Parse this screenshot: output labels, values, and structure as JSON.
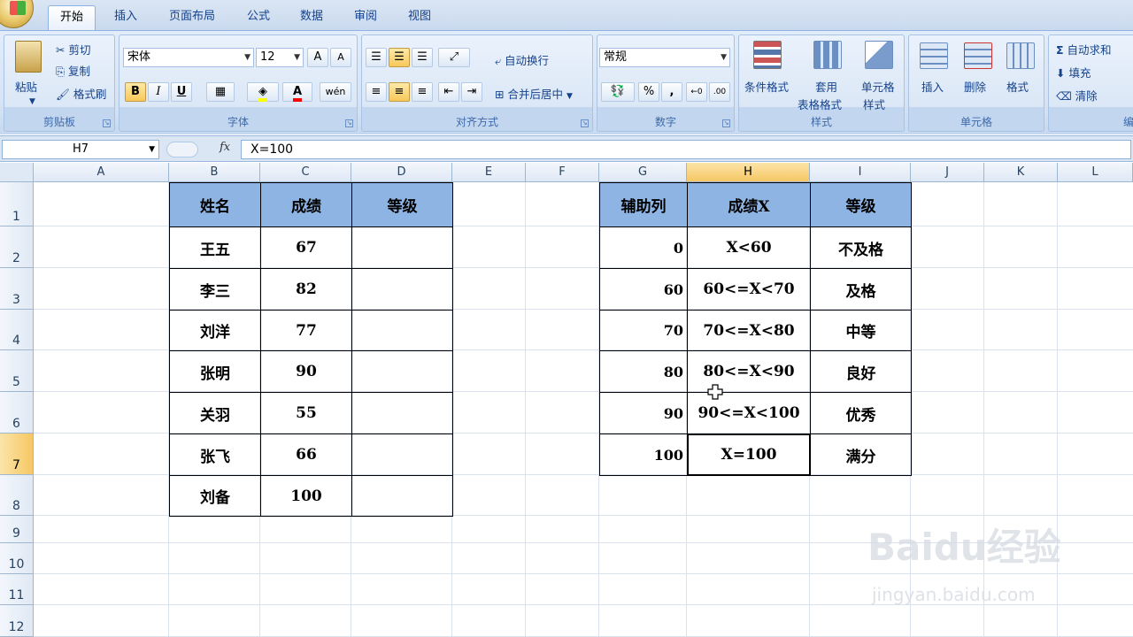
{
  "tabs": [
    "开始",
    "插入",
    "页面布局",
    "公式",
    "数据",
    "审阅",
    "视图"
  ],
  "clipboard": {
    "paste": "粘贴",
    "cut": "剪切",
    "copy": "复制",
    "format_painter": "格式刷",
    "label": "剪贴板"
  },
  "font": {
    "name": "宋体",
    "size": "12",
    "bold": "B",
    "italic": "I",
    "underline": "U",
    "grow": "A",
    "shrink": "A",
    "label": "字体"
  },
  "alignment": {
    "wrap": "自动换行",
    "merge": "合并后居中",
    "label": "对齐方式"
  },
  "number": {
    "format": "常规",
    "percent": "%",
    "comma": ",",
    "label": "数字"
  },
  "styles": {
    "conditional": "条件格式",
    "table_1": "套用",
    "table_2": "表格格式",
    "cell_1": "单元格",
    "cell_2": "样式",
    "label": "样式"
  },
  "cells": {
    "insert": "插入",
    "delete": "删除",
    "format": "格式",
    "label": "单元格"
  },
  "editing": {
    "autosum": "自动求和",
    "fill": "填充",
    "clear": "清除",
    "label": "编"
  },
  "formula_bar": {
    "name_box": "H7",
    "fx": "fx",
    "formula": "X=100"
  },
  "columns": [
    "A",
    "B",
    "C",
    "D",
    "E",
    "F",
    "G",
    "H",
    "I",
    "J",
    "K",
    "L"
  ],
  "selected_column": "H",
  "rows": [
    "1",
    "2",
    "3",
    "4",
    "5",
    "6",
    "7",
    "8",
    "9",
    "10",
    "11",
    "12"
  ],
  "selected_row": "7",
  "table1": {
    "headers": [
      "姓名",
      "成绩",
      "等级"
    ],
    "rows": [
      [
        "王五",
        "67",
        ""
      ],
      [
        "李三",
        "82",
        ""
      ],
      [
        "刘洋",
        "77",
        ""
      ],
      [
        "张明",
        "90",
        ""
      ],
      [
        "关羽",
        "55",
        ""
      ],
      [
        "张飞",
        "66",
        ""
      ],
      [
        "刘备",
        "100",
        ""
      ]
    ]
  },
  "table2": {
    "headers": [
      "辅助列",
      "成绩X",
      "等级"
    ],
    "rows": [
      [
        "0",
        "X<60",
        "不及格"
      ],
      [
        "60",
        "60<=X<70",
        "及格"
      ],
      [
        "70",
        "70<=X<80",
        "中等"
      ],
      [
        "80",
        "80<=X<90",
        "良好"
      ],
      [
        "90",
        "90<=X<100",
        "优秀"
      ],
      [
        "100",
        "X=100",
        "满分"
      ]
    ]
  },
  "watermark": {
    "logo": "Baidu经验",
    "url": "jingyan.baidu.com"
  }
}
